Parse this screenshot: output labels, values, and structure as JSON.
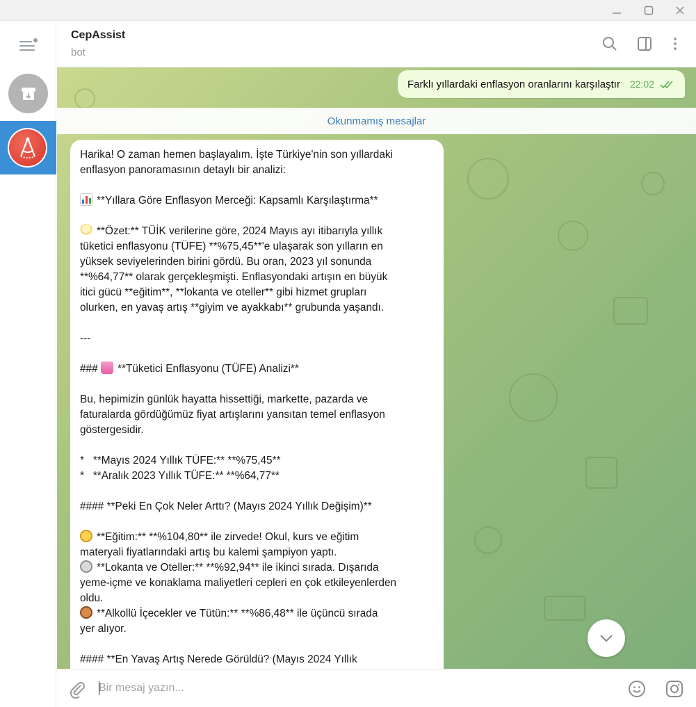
{
  "header": {
    "title": "CepAssist",
    "subtitle": "bot"
  },
  "chat": {
    "outgoing": {
      "text": "Farklı yıllardaki enflasyon oranlarını karşılaştır",
      "time": "22:02"
    },
    "unread_label": "Okunmamış mesajlar",
    "incoming_lines": [
      "Harika! O zaman hemen başlayalım. İşte Türkiye'nin son yıllardaki",
      "enflasyon panoramasının detaylı bir analizi:",
      "",
      "**Yıllara Göre Enflasyon Merceği: Kapsamlı Karşılaştırma**",
      "",
      "**Özet:** TÜİK verilerine göre, 2024 Mayıs ayı itibarıyla yıllık",
      "tüketici enflasyonu (TÜFE) **%75,45**'e ulaşarak son yılların en",
      "yüksek seviyelerinden birini gördü. Bu oran, 2023 yıl sonunda",
      "**%64,77** olarak gerçekleşmişti. Enflasyondaki artışın en büyük",
      "itici gücü **eğitim**, **lokanta ve oteller** gibi hizmet grupları",
      "olurken, en yavaş artış **giyim ve ayakkabı** grubunda yaşandı.",
      "",
      "---",
      "",
      "### ",
      "**Tüketici Enflasyonu (TÜFE) Analizi**",
      "",
      "Bu, hepimizin günlük hayatta hissettiği, markette, pazarda ve",
      "faturalarda gördüğümüz fiyat artışlarını yansıtan temel enflasyon",
      "göstergesidir.",
      "",
      "*   **Mayıs 2024 Yıllık TÜFE:** **%75,45**",
      "*   **Aralık 2023 Yıllık TÜFE:** **%64,77**",
      "",
      "#### **Peki En Çok Neler Arttı? (Mayıs 2024 Yıllık Değişim)**",
      "",
      "**Eğitim:** **%104,80** ile zirvede! Okul, kurs ve eğitim",
      "materyali fiyatlarındaki artış bu kalemi şampiyon yaptı.",
      "**Lokanta ve Oteller:** **%92,94** ile ikinci sırada. Dışarıda",
      "yeme-içme ve konaklama maliyetleri cepleri en çok etkileyenlerden",
      "oldu.",
      "**Alkollü İçecekler ve Tütün:** **%86,48** ile üçüncü sırada",
      "yer alıyor.",
      "",
      "#### **En Yavaş Artış Nerede Görüldü? (Mayıs 2024 Yıllık"
    ]
  },
  "composer": {
    "placeholder": "Bir mesaj yazın..."
  },
  "icons": {
    "menu": "menu-icon",
    "archive": "archive-icon",
    "search": "search-icon",
    "sidebar": "sidebar-toggle-icon",
    "more": "more-vertical-icon",
    "attach": "paperclip-icon",
    "emoji": "emoji-icon",
    "camera": "instagram-camera-icon",
    "scroll": "chevron-down-icon"
  },
  "colors": {
    "accent": "#3a8fd6",
    "outgoing_bubble": "#effdde",
    "read_ticks": "#5faf5c",
    "unread_text": "#3d7fba"
  }
}
